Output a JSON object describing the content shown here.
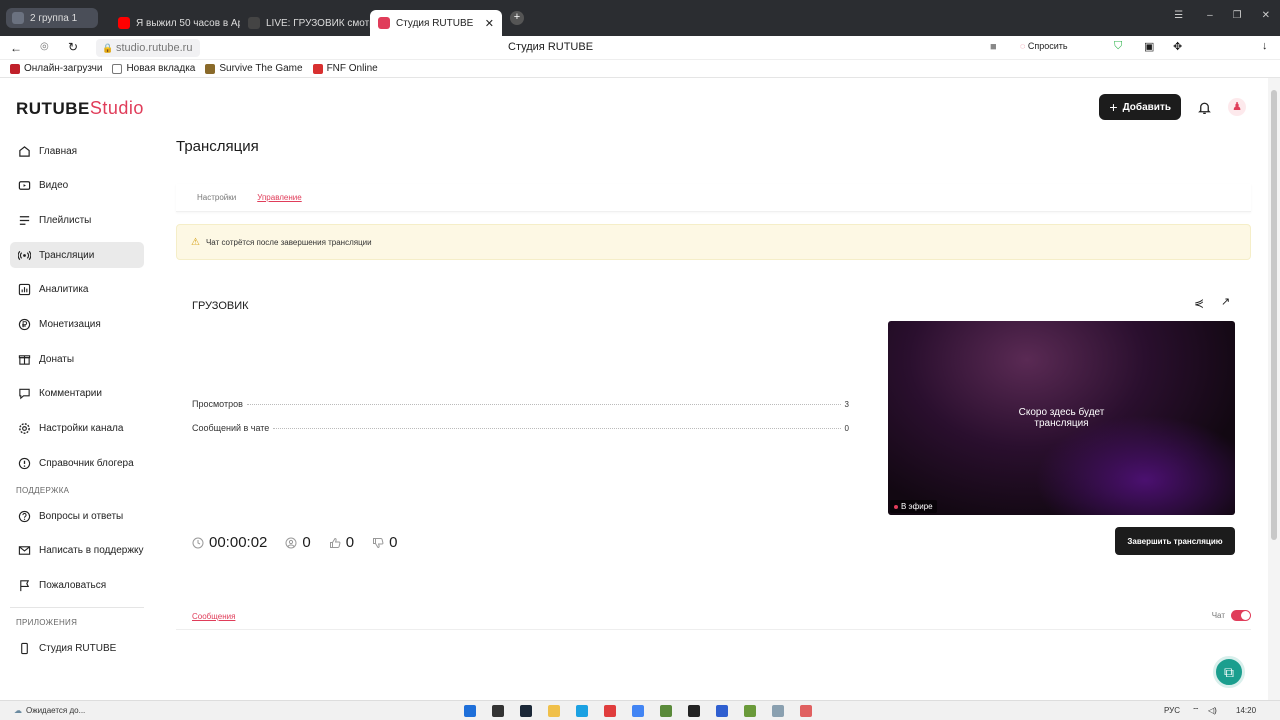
{
  "browser": {
    "group_label": "2 группа 1",
    "tabs": [
      {
        "title": "Я выжил 50 часов в Appl",
        "color": "#ff0000"
      },
      {
        "title": "LIVE: ГРУЗОВИК смотре",
        "color": "#333333"
      },
      {
        "title": "Студия RUTUBE",
        "color": "#e03d5a"
      }
    ],
    "url": "studio.rutube.ru",
    "page_title": "Студия RUTUBE",
    "ask_label": "Спросить",
    "bookmarks": [
      "Онлайн-загрузчи",
      "Новая вкладка",
      "Survive The Game",
      "FNF Online"
    ]
  },
  "app": {
    "logo_main": "RUTUBE",
    "logo_sub": "Studio",
    "add_button": "Добавить",
    "accent_color": "#e03d5a",
    "nav": [
      {
        "label": "Главная",
        "icon": "home-icon"
      },
      {
        "label": "Видео",
        "icon": "video-icon"
      },
      {
        "label": "Плейлисты",
        "icon": "playlist-icon"
      },
      {
        "label": "Трансляции",
        "icon": "broadcast-icon",
        "active": true
      },
      {
        "label": "Аналитика",
        "icon": "analytics-icon"
      },
      {
        "label": "Монетизация",
        "icon": "money-icon"
      },
      {
        "label": "Донаты",
        "icon": "donate-icon"
      },
      {
        "label": "Комментарии",
        "icon": "comment-icon"
      },
      {
        "label": "Настройки канала",
        "icon": "settings-icon"
      },
      {
        "label": "Справочник блогера",
        "icon": "help-icon"
      }
    ],
    "support_title": "ПОДДЕРЖКА",
    "support": [
      "Вопросы и ответы",
      "Написать в поддержку",
      "Пожаловаться"
    ],
    "apps_title": "ПРИЛОЖЕНИЯ",
    "apps": [
      "Студия RUTUBE"
    ]
  },
  "page": {
    "title": "Трансляция",
    "tabs": [
      "Настройки",
      "Управление"
    ],
    "active_tab": "Управление",
    "warning": "Чат сотрётся после завершения трансляции",
    "stream_name": "ГРУЗОВИК",
    "stats": [
      {
        "label": "Просмотров",
        "value": "3"
      },
      {
        "label": "Сообщений в чате",
        "value": "0"
      }
    ],
    "timer": "00:00:02",
    "viewers": "0",
    "likes": "0",
    "dislikes": "0",
    "preview_caption_1": "Скоро здесь будет",
    "preview_caption_2": "трансляция",
    "live_badge": "В эфире",
    "end_button": "Завершить трансляцию",
    "messages_tab": "Сообщения",
    "chat_label": "Чат",
    "chat_enabled": true
  },
  "taskbar": {
    "status": "Ожидается до...",
    "lang": "РУС",
    "time": "14:20"
  }
}
